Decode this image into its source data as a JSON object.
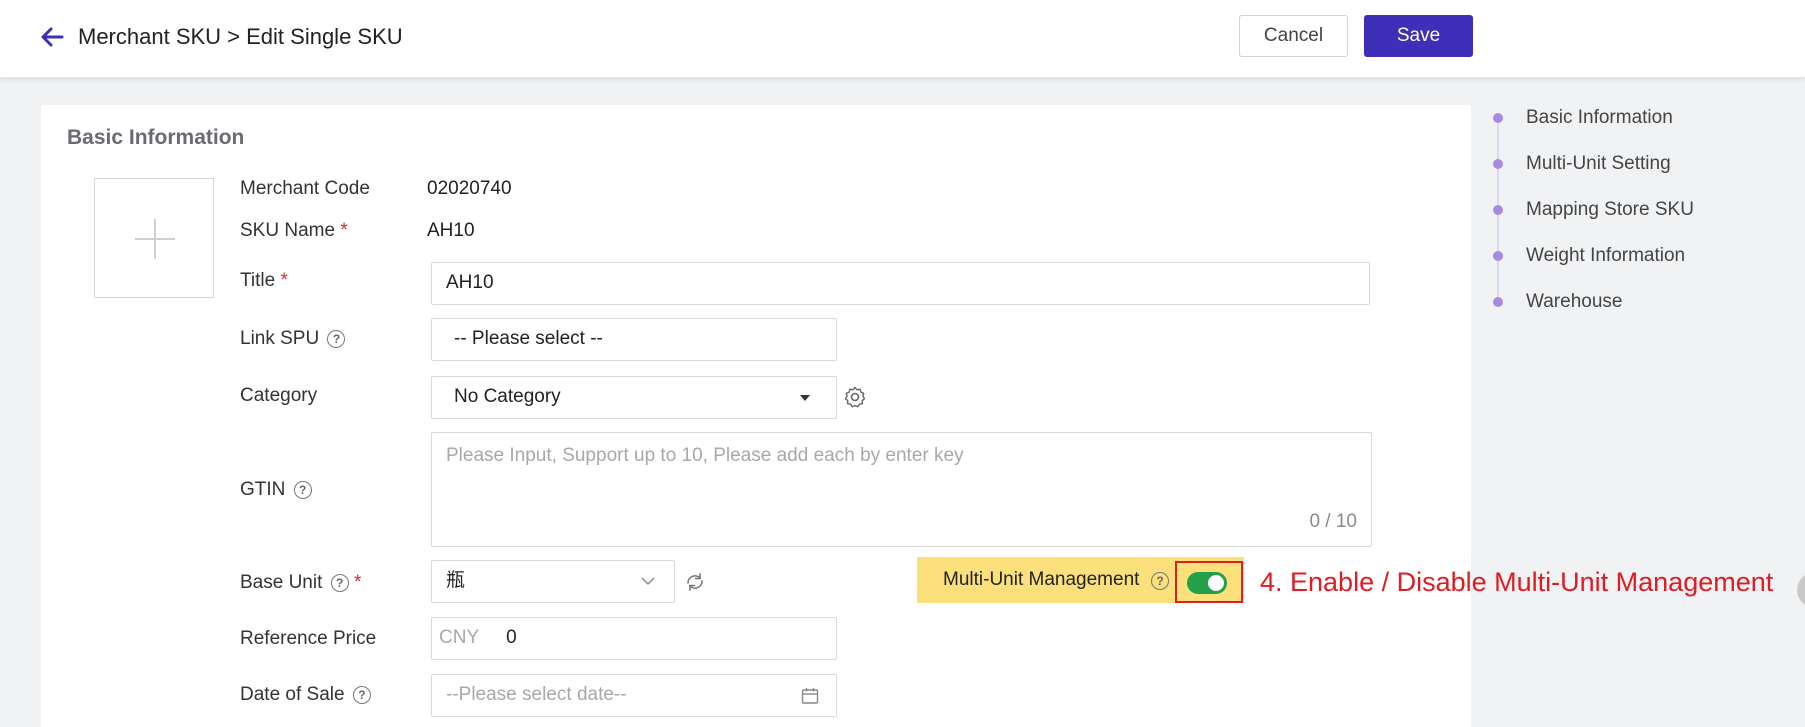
{
  "header": {
    "title": "Merchant SKU > Edit Single SKU",
    "cancel_label": "Cancel",
    "save_label": "Save",
    "accent_color": "#3f2fb8"
  },
  "basic": {
    "section_title": "Basic Information",
    "merchant_code_label": "Merchant Code",
    "merchant_code_value": "02020740",
    "sku_name_label": "SKU Name",
    "sku_name_value": "AH10",
    "title_label": "Title",
    "title_value": "AH10",
    "link_spu_label": "Link SPU",
    "link_spu_placeholder": "-- Please select --",
    "category_label": "Category",
    "category_value": "No Category",
    "gtin_label": "GTIN",
    "gtin_placeholder": "Please Input, Support up to 10, Please add each by enter key",
    "gtin_counter": "0 / 10",
    "base_unit_label": "Base Unit",
    "base_unit_value": "瓶",
    "reference_price_label": "Reference Price",
    "reference_price_currency": "CNY",
    "reference_price_value": "0",
    "date_of_sale_label": "Date of Sale",
    "date_of_sale_placeholder": "--Please select date--",
    "required_mark": "*",
    "help_mark": "?"
  },
  "multi_unit": {
    "label": "Multi-Unit Management",
    "enabled": true,
    "toggle_color": "#24a148",
    "annotation": "4. Enable / Disable Multi-Unit Management"
  },
  "side_nav": {
    "items": [
      {
        "label": "Basic Information"
      },
      {
        "label": "Multi-Unit Setting"
      },
      {
        "label": "Mapping Store SKU"
      },
      {
        "label": "Weight Information"
      },
      {
        "label": "Warehouse"
      }
    ]
  },
  "icons": {
    "back": "arrow-left-icon",
    "gear": "gear-icon",
    "refresh": "refresh-icon",
    "calendar": "calendar-icon",
    "help": "question-circle-icon"
  }
}
